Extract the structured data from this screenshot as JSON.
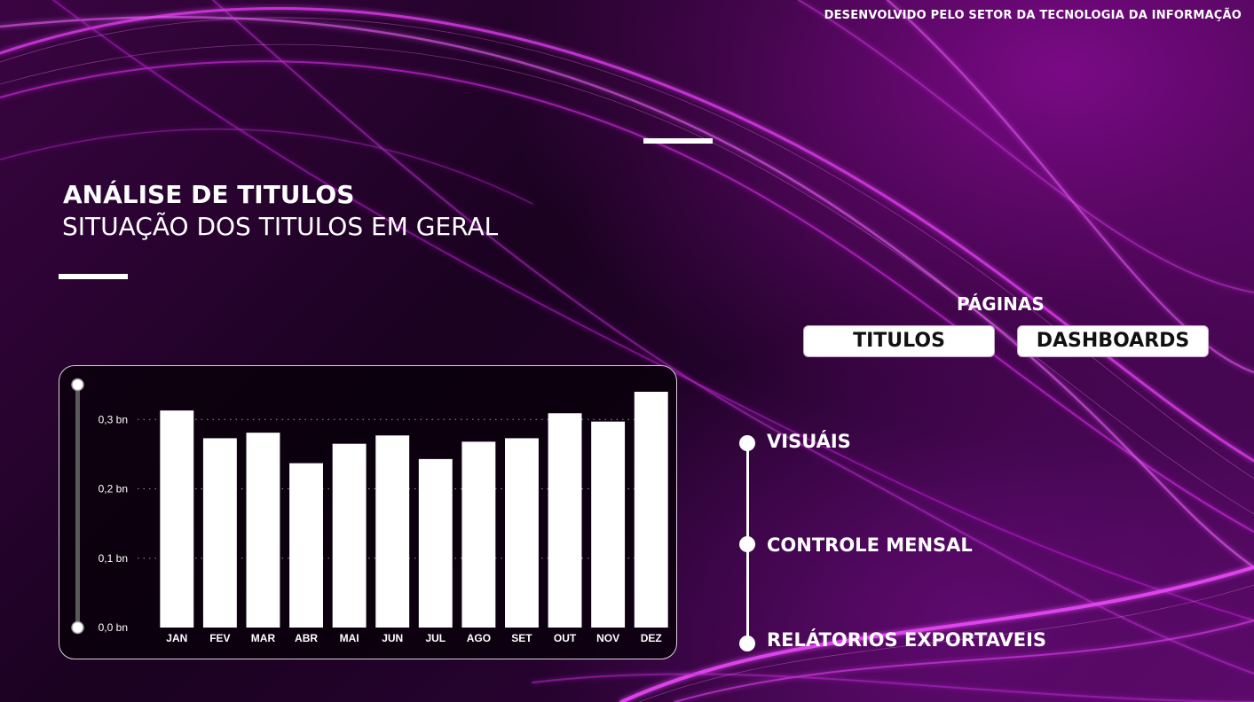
{
  "header": {
    "credit": "DESENVOLVIDO PELO SETOR DA TECNOLOGIA DA INFORMAÇÃO"
  },
  "hero": {
    "title": "ANÁLISE DE TITULOS",
    "subtitle": "SITUAÇÃO DOS TITULOS EM GERAL"
  },
  "pages": {
    "heading": "PÁGINAS",
    "buttons": [
      "TITULOS",
      "DASHBOARDS"
    ]
  },
  "nav": {
    "items": [
      "VISUÁIS",
      "CONTROLE MENSAL",
      "RELÁTORIOS EXPORTAVEIS"
    ]
  },
  "colors": {
    "bar": "#ffffff",
    "accent": "#c21fd6",
    "background": "#1a0220"
  },
  "chart_data": {
    "type": "bar",
    "categories": [
      "JAN",
      "FEV",
      "MAR",
      "ABR",
      "MAI",
      "JUN",
      "JUL",
      "AGO",
      "SET",
      "OUT",
      "NOV",
      "DEZ"
    ],
    "values": [
      0.313,
      0.273,
      0.281,
      0.237,
      0.265,
      0.277,
      0.243,
      0.268,
      0.273,
      0.309,
      0.297,
      0.34
    ],
    "y_ticks": [
      0,
      0.1,
      0.2,
      0.3
    ],
    "y_tick_labels": [
      "0,0 bn",
      "0,1 bn",
      "0,2 bn",
      "0,3 bn"
    ],
    "ylim": [
      0,
      0.34
    ],
    "grid": "dotted horizontal"
  }
}
